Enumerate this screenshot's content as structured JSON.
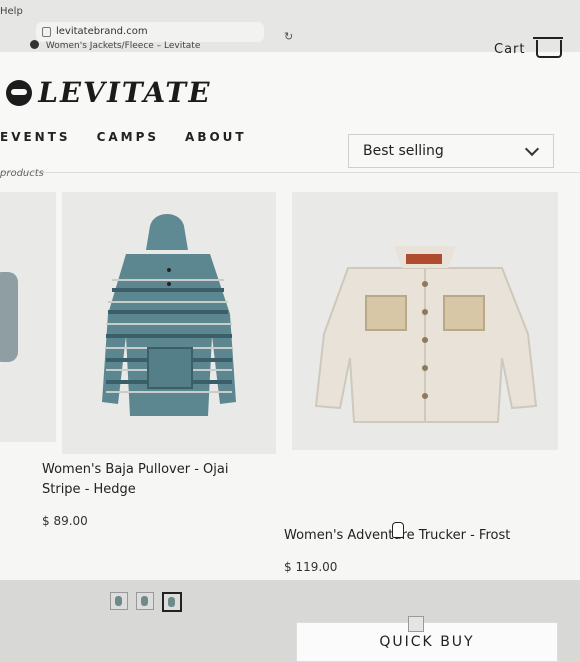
{
  "browser": {
    "help_label": "Help",
    "url": "levitatebrand.com",
    "tab_title": "Women's Jackets/Fleece – Levitate"
  },
  "header": {
    "logo_text": "LEVITATE",
    "cart_label": "Cart"
  },
  "nav": {
    "items": [
      "EVENTS",
      "CAMPS",
      "ABOUT"
    ]
  },
  "collection": {
    "product_count_label": "products",
    "sort_selected": "Best selling"
  },
  "products": [
    {
      "title": "Women's Baja Pullover - Ojai Stripe - Hedge",
      "price": "$ 89.00"
    },
    {
      "title": "Women's Adventure Trucker - Frost",
      "price": "$ 119.00",
      "quick_buy_label": "QUICK BUY"
    }
  ],
  "colors": {
    "background": "#f6f6f4",
    "text": "#222222",
    "baja_stripe_teal": "#5f8a93",
    "trucker_frost": "#e8e2d8",
    "trucker_pocket": "#d8c7a6"
  }
}
